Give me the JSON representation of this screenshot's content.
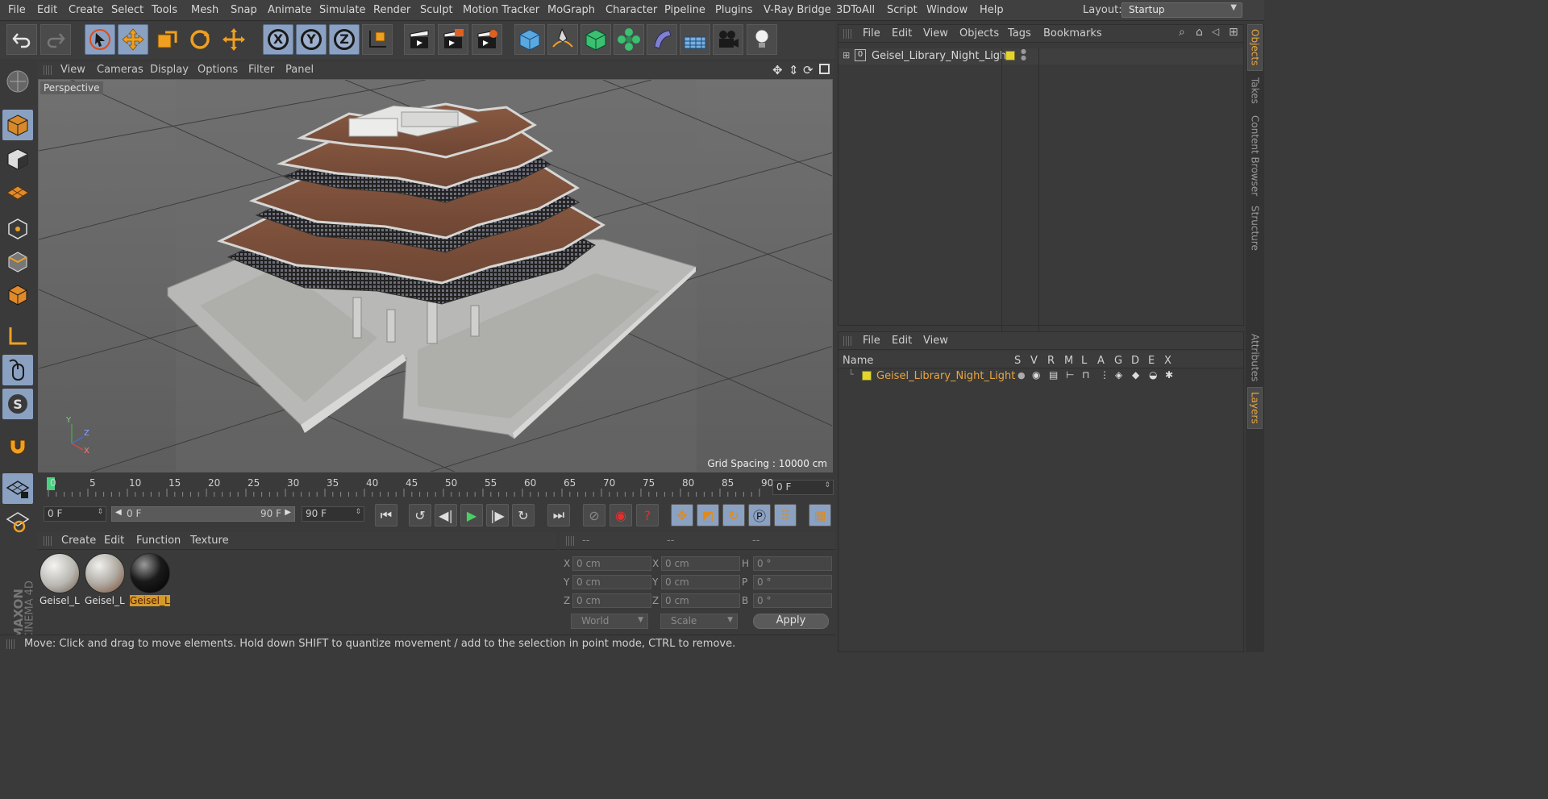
{
  "menubar": {
    "items": [
      "File",
      "Edit",
      "Create",
      "Select",
      "Tools",
      "Mesh",
      "Snap",
      "Animate",
      "Simulate",
      "Render",
      "Sculpt",
      "Motion Tracker",
      "MoGraph",
      "Character",
      "Pipeline",
      "Plugins",
      "V-Ray Bridge",
      "3DToAll",
      "Script",
      "Window",
      "Help"
    ],
    "layout_label": "Layout:",
    "layout_value": "Startup"
  },
  "toolbar": {
    "axis_x": "X",
    "axis_y": "Y",
    "axis_z": "Z"
  },
  "viewport": {
    "menu": [
      "View",
      "Cameras",
      "Display",
      "Options",
      "Filter",
      "Panel"
    ],
    "label": "Perspective",
    "grid_spacing": "Grid Spacing : 10000 cm",
    "gizmo": {
      "y": "Y",
      "z": "Z",
      "x": "X"
    }
  },
  "timeline": {
    "ticks": [
      "0",
      "5",
      "10",
      "15",
      "20",
      "25",
      "30",
      "35",
      "40",
      "45",
      "50",
      "55",
      "60",
      "65",
      "70",
      "75",
      "80",
      "85",
      "90"
    ],
    "current_frame": "0 F"
  },
  "playbar": {
    "start": "0 F",
    "range_start": "0 F",
    "range_end": "90 F",
    "end": "90 F"
  },
  "materials": {
    "menu": [
      "Create",
      "Edit",
      "Function",
      "Texture"
    ],
    "items": [
      {
        "name": "Geisel_L"
      },
      {
        "name": "Geisel_L"
      },
      {
        "name": "Geisel_L"
      }
    ]
  },
  "coordinates": {
    "headers": [
      "--",
      "--",
      "--"
    ],
    "col1": [
      {
        "label": "X",
        "value": "0 cm"
      },
      {
        "label": "Y",
        "value": "0 cm"
      },
      {
        "label": "Z",
        "value": "0 cm"
      }
    ],
    "col2": [
      {
        "label": "X",
        "value": "0 cm"
      },
      {
        "label": "Y",
        "value": "0 cm"
      },
      {
        "label": "Z",
        "value": "0 cm"
      }
    ],
    "col3": [
      {
        "label": "H",
        "value": "0 °"
      },
      {
        "label": "P",
        "value": "0 °"
      },
      {
        "label": "B",
        "value": "0 °"
      }
    ],
    "mode": "World",
    "scale": "Scale",
    "apply": "Apply"
  },
  "status": "Move: Click and drag to move elements. Hold down SHIFT to quantize movement / add to the selection in point mode, CTRL to remove.",
  "objects": {
    "menu": [
      "File",
      "Edit",
      "View",
      "Objects",
      "Tags",
      "Bookmarks"
    ],
    "row_name": "Geisel_Library_Night_Light",
    "row_icon": "L0"
  },
  "layers": {
    "menu": [
      "File",
      "Edit",
      "View"
    ],
    "col_name": "Name",
    "cols": [
      "S",
      "V",
      "R",
      "M",
      "L",
      "A",
      "G",
      "D",
      "E",
      "X"
    ],
    "row_name": "Geisel_Library_Night_Light"
  },
  "side_tabs": [
    "Objects",
    "Takes",
    "Content Browser",
    "Structure",
    "Attributes",
    "Layers"
  ],
  "brand": {
    "line1": "MAXON",
    "line2": "CINEMA 4D"
  },
  "colors": {
    "accent": "#e8a640",
    "layer": "#e4d42e",
    "selected_tool": "#8aa1c2"
  }
}
